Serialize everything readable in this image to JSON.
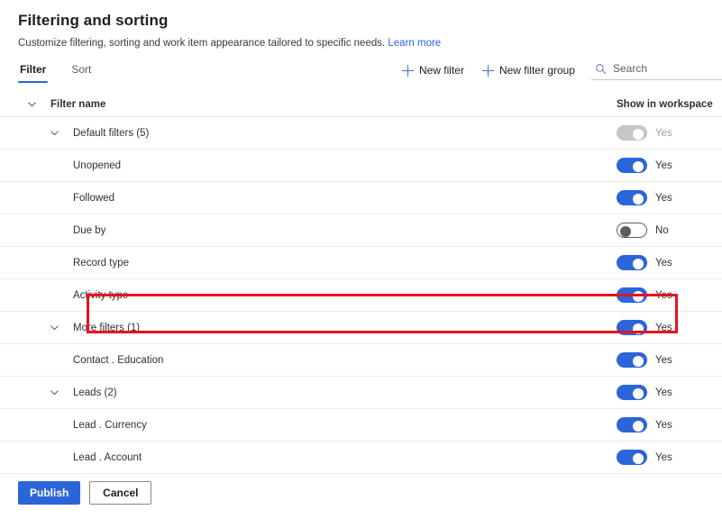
{
  "header": {
    "title": "Filtering and sorting",
    "subtitle": "Customize filtering, sorting and work item appearance tailored to specific needs.",
    "learn_more": "Learn more"
  },
  "tabs": [
    {
      "label": "Filter",
      "active": true
    },
    {
      "label": "Sort",
      "active": false
    }
  ],
  "commands": {
    "new_filter": "New filter",
    "new_filter_group": "New filter group",
    "search": {
      "placeholder": "Search",
      "value": ""
    }
  },
  "table": {
    "columns": {
      "name": "Filter name",
      "workspace": "Show in workspace"
    },
    "rows": [
      {
        "label": "Default filters (5)",
        "level": "group",
        "chevron": true,
        "toggle": "disabled",
        "toggle_label": "Yes",
        "highlighted": false
      },
      {
        "label": "Unopened",
        "level": "child",
        "chevron": false,
        "toggle": "on",
        "toggle_label": "Yes",
        "highlighted": false
      },
      {
        "label": "Followed",
        "level": "child",
        "chevron": false,
        "toggle": "on",
        "toggle_label": "Yes",
        "highlighted": false
      },
      {
        "label": "Due by",
        "level": "child",
        "chevron": false,
        "toggle": "off",
        "toggle_label": "No",
        "highlighted": true
      },
      {
        "label": "Record type",
        "level": "child",
        "chevron": false,
        "toggle": "on",
        "toggle_label": "Yes",
        "highlighted": false
      },
      {
        "label": "Activity type",
        "level": "child",
        "chevron": false,
        "toggle": "on",
        "toggle_label": "Yes",
        "highlighted": false
      },
      {
        "label": "More filters (1)",
        "level": "group",
        "chevron": true,
        "toggle": "on",
        "toggle_label": "Yes",
        "highlighted": false
      },
      {
        "label": "Contact . Education",
        "level": "child",
        "chevron": false,
        "toggle": "on",
        "toggle_label": "Yes",
        "highlighted": false
      },
      {
        "label": "Leads (2)",
        "level": "group",
        "chevron": true,
        "toggle": "on",
        "toggle_label": "Yes",
        "highlighted": false
      },
      {
        "label": "Lead . Currency",
        "level": "child",
        "chevron": false,
        "toggle": "on",
        "toggle_label": "Yes",
        "highlighted": false
      },
      {
        "label": "Lead . Account",
        "level": "child",
        "chevron": false,
        "toggle": "on",
        "toggle_label": "Yes",
        "highlighted": false
      }
    ]
  },
  "footer": {
    "publish": "Publish",
    "cancel": "Cancel"
  },
  "colors": {
    "accent": "#2b65d9",
    "toggle_on": "#2b65d9",
    "toggle_disabled": "#c8c6c4",
    "highlight": "#e81123",
    "divider": "#edebe9"
  },
  "icons": {
    "plus": "plus-icon",
    "search": "search-icon",
    "chevron_down": "chevron-down-icon"
  }
}
